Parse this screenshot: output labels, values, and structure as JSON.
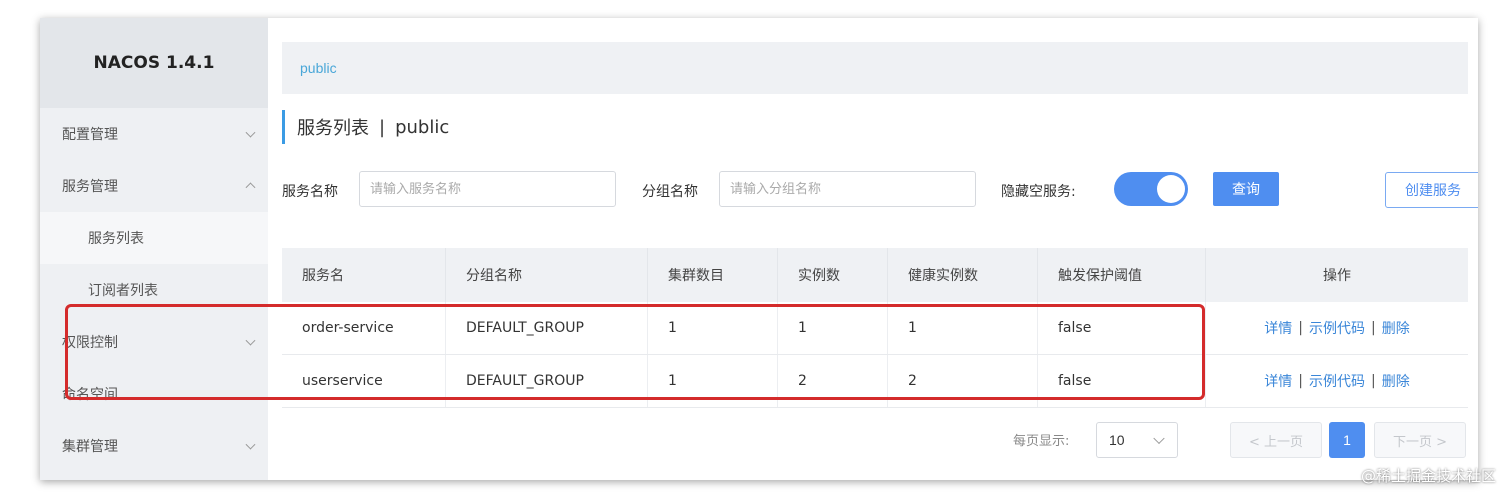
{
  "app": {
    "brand": "NACOS 1.4.1"
  },
  "sidebar": {
    "items": [
      {
        "label": "配置管理",
        "chevron": "chevron-down-icon"
      },
      {
        "label": "服务管理",
        "chevron": "chevron-up-icon"
      },
      {
        "label": "服务列表"
      },
      {
        "label": "订阅者列表"
      },
      {
        "label": "权限控制",
        "chevron": "chevron-down-icon"
      },
      {
        "label": "命名空间"
      },
      {
        "label": "集群管理",
        "chevron": "chevron-down-icon"
      }
    ]
  },
  "namespace_bar": {
    "current": "public"
  },
  "page": {
    "title": "服务列表",
    "separator": "|",
    "namespace": "public"
  },
  "filters": {
    "service_label": "服务名称",
    "service_placeholder": "请输入服务名称",
    "group_label": "分组名称",
    "group_placeholder": "请输入分组名称",
    "hide_empty_label": "隐藏空服务:",
    "hide_empty_on": true,
    "query_button": "查询",
    "create_button": "创建服务"
  },
  "table": {
    "headers": [
      "服务名",
      "分组名称",
      "集群数目",
      "实例数",
      "健康实例数",
      "触发保护阈值",
      "操作"
    ],
    "rows": [
      {
        "name": "order-service",
        "group": "DEFAULT_GROUP",
        "clusters": "1",
        "instances": "1",
        "healthy": "1",
        "threshold": "false"
      },
      {
        "name": "userservice",
        "group": "DEFAULT_GROUP",
        "clusters": "1",
        "instances": "2",
        "healthy": "2",
        "threshold": "false"
      }
    ],
    "actions": {
      "detail": "详情",
      "sample": "示例代码",
      "delete": "删除",
      "sep": "|"
    }
  },
  "pagination": {
    "per_page_label": "每页显示:",
    "per_page": "10",
    "prev": "< 上一页",
    "current_page": "1",
    "next": "下一页 >"
  },
  "watermark": "@稀土掘金技术社区",
  "colors": {
    "primary": "#4f8ef0",
    "link": "#3a86d8",
    "highlight": "#d42b2b"
  }
}
